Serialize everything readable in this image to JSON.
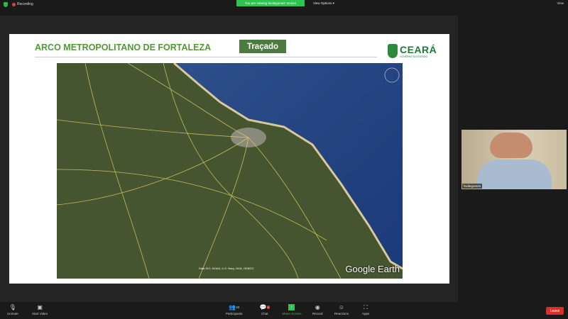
{
  "topbar": {
    "recording": "Recording",
    "banner": "You are viewing facilegomes' screen",
    "view_options": "View Options ▾",
    "view": "View"
  },
  "slide": {
    "title": "ARCO METROPOLITANO DE FORTALEZA",
    "badge": "Traçado",
    "logo": "CEARÁ",
    "logo_sub": "GOVERNO DO ESTADO"
  },
  "map": {
    "brand": "Google Earth",
    "attribution": "Data SIO, NOAA, U.S. Navy, NGA, GEBCO"
  },
  "participant": {
    "name": "facilegomes"
  },
  "toolbar": {
    "unmute": "Unmute",
    "start_video": "Start Video",
    "participants": "Participants",
    "participant_count": "40",
    "chat": "Chat",
    "chat_badge": "1",
    "share_screen": "Share Screen",
    "record": "Record",
    "reactions": "Reactions",
    "apps": "Apps",
    "leave": "Leave"
  },
  "colors": {
    "accent_green": "#2fc34f",
    "title_green": "#4f9a33",
    "leave_red": "#d9302b"
  }
}
